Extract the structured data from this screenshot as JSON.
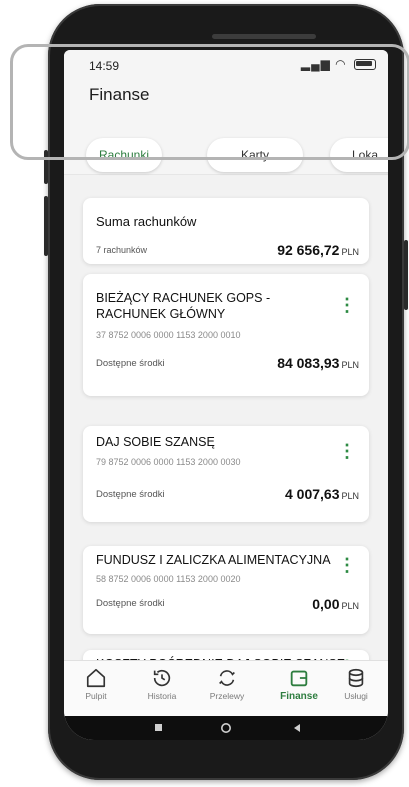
{
  "status_bar": {
    "time": "14:59",
    "signal": "▂▄▆ ◠"
  },
  "header": {
    "title": "Finanse"
  },
  "tabs": [
    {
      "label": "Rachunki",
      "active": true
    },
    {
      "label": "Karty",
      "active": false
    },
    {
      "label": "Loka",
      "active": false
    }
  ],
  "summary": {
    "title": "Suma rachunków",
    "count_label": "7 rachunków",
    "amount": "92 656,72",
    "currency": "PLN"
  },
  "accounts": [
    {
      "name": "BIEŻĄCY RACHUNEK GOPS - RACHUNEK GŁÓWNY",
      "number": "37 8752 0006 0000 1153 2000 0010",
      "label": "Dostępne środki",
      "amount": "84 083,93",
      "currency": "PLN"
    },
    {
      "name": "DAJ SOBIE SZANSĘ",
      "number": "79 8752 0006 0000 1153 2000 0030",
      "label": "Dostępne środki",
      "amount": "4 007,63",
      "currency": "PLN"
    },
    {
      "name": "FUNDUSZ I ZALICZKA ALIMENTACYJNA",
      "number": "58 8752 0006 0000 1153 2000 0020",
      "label": "Dostępne środki",
      "amount": "0,00",
      "currency": "PLN"
    },
    {
      "name": "KOSZTY POŚREDNIE DAJ SOBIE SZANSĘ"
    }
  ],
  "kebab_glyph": "⋮",
  "bottom_nav": [
    {
      "label": "Pulpit",
      "icon": "home-icon"
    },
    {
      "label": "Historia",
      "icon": "history-icon"
    },
    {
      "label": "Przelewy",
      "icon": "transfer-icon"
    },
    {
      "label": "Finanse",
      "icon": "wallet-icon",
      "active": true
    },
    {
      "label": "Usługi",
      "icon": "services-icon"
    }
  ],
  "colors": {
    "accent": "#2d7d3f",
    "kebab": "#2d8a43"
  }
}
